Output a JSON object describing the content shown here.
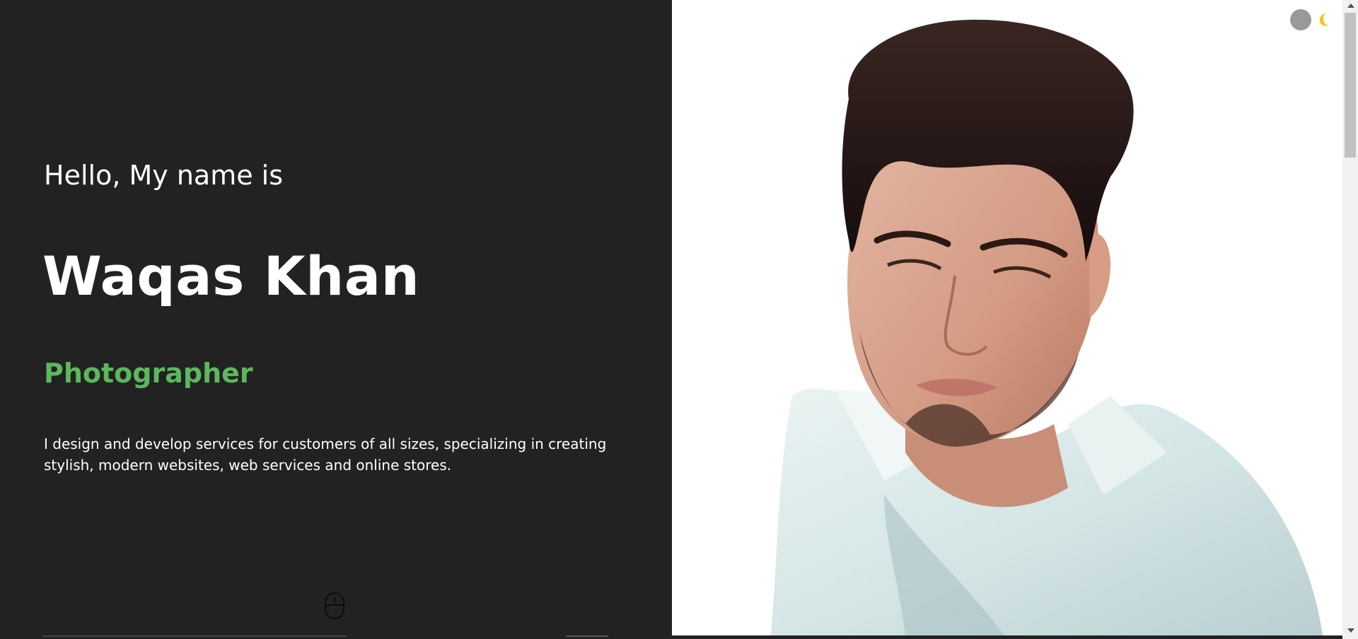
{
  "hero": {
    "greeting": "Hello, My name is",
    "name": "Waqas Khan",
    "role": "Photographer",
    "description": "I design and develop services for customers of all sizes, specializing in creating stylish, modern websites, web services and online stores."
  },
  "theme_toggle": {
    "icon": "moon-icon",
    "knob_color": "#999999",
    "moon_color": "#f5c518"
  },
  "colors": {
    "background_dark": "#222222",
    "accent": "#5cb85c",
    "text": "#ffffff"
  },
  "scroll_indicator": {
    "icon": "mouse-scroll-icon"
  },
  "portrait": {
    "icon": "profile-photo"
  }
}
